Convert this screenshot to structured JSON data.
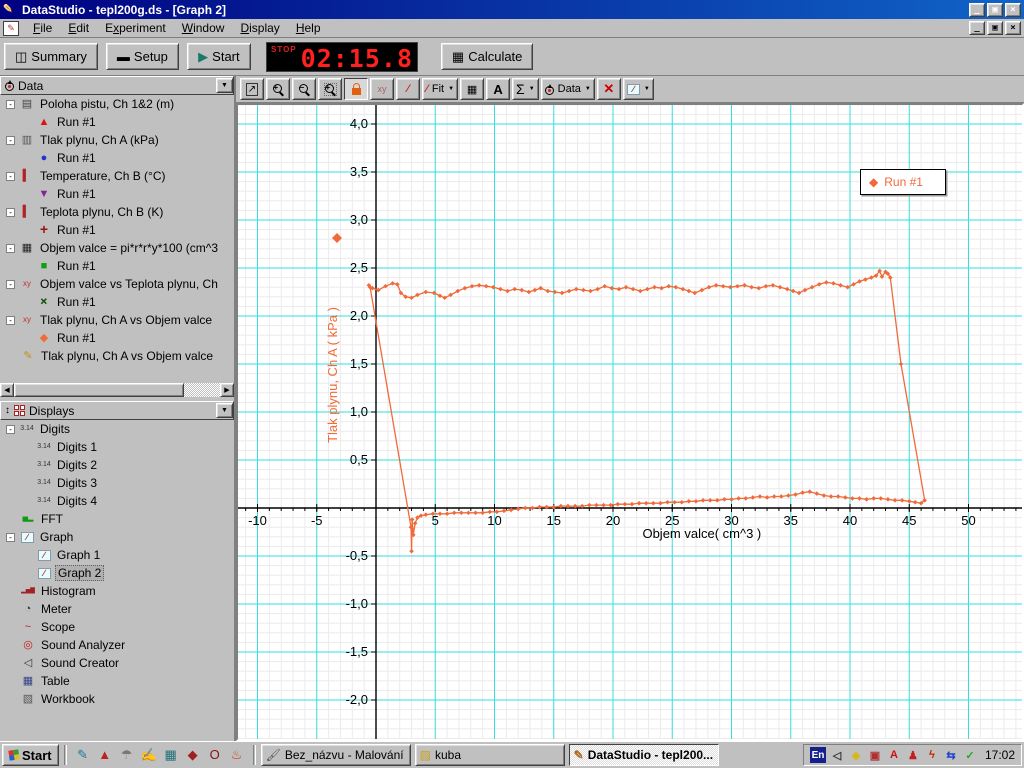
{
  "window": {
    "title": "DataStudio - tepl200g.ds - [Graph 2]"
  },
  "menu": {
    "items": [
      {
        "label": "File",
        "u": 0
      },
      {
        "label": "Edit",
        "u": 0
      },
      {
        "label": "Experiment",
        "u": 1
      },
      {
        "label": "Window",
        "u": 0
      },
      {
        "label": "Display",
        "u": 0
      },
      {
        "label": "Help",
        "u": 0
      }
    ]
  },
  "main_toolbar": {
    "summary_label": "Summary",
    "setup_label": "Setup",
    "start_label": "Start",
    "calculate_label": "Calculate",
    "timer": {
      "stop_label": "STOP",
      "value": "02:15.8"
    }
  },
  "graph_toolbar": {
    "buttons": [
      {
        "name": "scale-to-fit-button",
        "icon": "scalefit"
      },
      {
        "name": "zoom-in-button",
        "icon": "mag-plus"
      },
      {
        "name": "zoom-out-button",
        "icon": "mag-minus"
      },
      {
        "name": "zoom-select-button",
        "icon": "mag-rect"
      },
      {
        "name": "smart-tool-button",
        "icon": "lock",
        "pressed": true
      },
      {
        "name": "xy-tool-button",
        "icon": "xy",
        "disabled": true
      },
      {
        "name": "slope-tool-button",
        "icon": "slope",
        "disabled": true
      },
      {
        "name": "fit-menu-button",
        "icon": "slope",
        "label": "Fit",
        "arrow": true
      },
      {
        "name": "calculator-button",
        "icon": "calc"
      },
      {
        "name": "text-tool-button",
        "icon": "textA"
      },
      {
        "name": "statistics-button",
        "icon": "sigma",
        "arrow": true
      },
      {
        "name": "data-menu-button",
        "icon": "droplet",
        "label": "Data",
        "arrow": true
      },
      {
        "name": "delete-button",
        "icon": "redx"
      },
      {
        "name": "graph-settings-button",
        "icon": "minigraph",
        "arrow": true
      }
    ]
  },
  "sidebar": {
    "data_panel": {
      "title": "Data",
      "icon": "droplet-icon",
      "items": [
        {
          "label": "Poloha pistu, Ch 1&2 (m)",
          "icon": "motion-sensor-icon",
          "level": 0,
          "expand": true
        },
        {
          "label": "Run #1",
          "marker": "triangle-up",
          "color": "#dd1111",
          "level": 1
        },
        {
          "label": "Tlak plynu, Ch A (kPa)",
          "icon": "pressure-sensor-icon",
          "level": 0,
          "expand": true
        },
        {
          "label": "Run #1",
          "marker": "circle",
          "color": "#2233cc",
          "level": 1
        },
        {
          "label": "Temperature, Ch B (°C)",
          "icon": "temperature-sensor-icon",
          "level": 0,
          "expand": true
        },
        {
          "label": "Run #1",
          "marker": "triangle-down",
          "color": "#882299",
          "level": 1
        },
        {
          "label": "Teplota plynu, Ch B (K)",
          "icon": "temperature-sensor-icon",
          "level": 0,
          "expand": true
        },
        {
          "label": "Run #1",
          "marker": "plus",
          "color": "#991111",
          "level": 1
        },
        {
          "label": "Objem valce = pi*r*r*y*100 (cm^3",
          "icon": "calculator-icon",
          "level": 0,
          "expand": true
        },
        {
          "label": "Run #1",
          "marker": "square",
          "color": "#11a011",
          "level": 1
        },
        {
          "label": "Objem valce vs Teplota plynu, Ch",
          "icon": "xy-data-icon",
          "level": 0,
          "expand": true
        },
        {
          "label": "Run #1",
          "marker": "x-cross",
          "color": "#115511",
          "level": 1
        },
        {
          "label": "Tlak plynu, Ch A vs Objem valce",
          "icon": "xy-data-icon",
          "level": 0,
          "expand": true
        },
        {
          "label": "Run #1",
          "marker": "diamond",
          "color": "#f06a3a",
          "level": 1
        },
        {
          "label": "Tlak plynu, Ch A vs Objem valce",
          "icon": "pencil-icon",
          "level": 0
        }
      ]
    },
    "displays_panel": {
      "title": "Displays",
      "icon": "grid-icon",
      "items": [
        {
          "label": "Digits",
          "icon": "digits-icon",
          "level": 0,
          "expand": true
        },
        {
          "label": "Digits 1",
          "icon": "digits-icon",
          "level": 1
        },
        {
          "label": "Digits 2",
          "icon": "digits-icon",
          "level": 1
        },
        {
          "label": "Digits 3",
          "icon": "digits-icon",
          "level": 1
        },
        {
          "label": "Digits 4",
          "icon": "digits-icon",
          "level": 1
        },
        {
          "label": "FFT",
          "icon": "fft-icon",
          "level": 0
        },
        {
          "label": "Graph",
          "icon": "graph-icon",
          "level": 0,
          "expand": true
        },
        {
          "label": "Graph 1",
          "icon": "graph-icon",
          "level": 1
        },
        {
          "label": "Graph 2",
          "icon": "graph-icon",
          "level": 1,
          "selected": true
        },
        {
          "label": "Histogram",
          "icon": "histogram-icon",
          "level": 0
        },
        {
          "label": "Meter",
          "icon": "meter-icon",
          "level": 0
        },
        {
          "label": "Scope",
          "icon": "scope-icon",
          "level": 0
        },
        {
          "label": "Sound Analyzer",
          "icon": "sound-analyzer-icon",
          "level": 0
        },
        {
          "label": "Sound Creator",
          "icon": "sound-creator-icon",
          "level": 0
        },
        {
          "label": "Table",
          "icon": "table-icon",
          "level": 0
        },
        {
          "label": "Workbook",
          "icon": "workbook-icon",
          "level": 0
        }
      ]
    }
  },
  "legend": {
    "label": "Run #1",
    "color": "#f06a3a"
  },
  "chart_data": {
    "type": "scatter",
    "title": "",
    "xlabel": "Objem valce( cm^3 )",
    "ylabel": "Tlak plynu, Ch A ( kPa )",
    "xlim": [
      -11.6,
      54.6
    ],
    "ylim": [
      -2.4,
      4.2
    ],
    "x_tick_step": 5,
    "x_minor_step": 1,
    "y_tick_step": 0.5,
    "y_minor_step": 0.1,
    "grid": "on",
    "legend_position": "upper-right",
    "axis_color": "#000000",
    "major_grid_color": "#33dede",
    "minor_grid_color": "#ebebeb",
    "series": [
      {
        "name": "Run #1",
        "color": "#f06a3a",
        "marker": "diamond",
        "points": [
          [
            -0.6,
            2.32
          ],
          [
            -0.3,
            2.29
          ],
          [
            0.2,
            2.27
          ],
          [
            0.8,
            2.31
          ],
          [
            1.4,
            2.34
          ],
          [
            1.8,
            2.33
          ],
          [
            2.1,
            2.24
          ],
          [
            2.5,
            2.2
          ],
          [
            3.0,
            2.19
          ],
          [
            3.5,
            2.22
          ],
          [
            4.2,
            2.25
          ],
          [
            4.9,
            2.24
          ],
          [
            5.4,
            2.21
          ],
          [
            5.8,
            2.19
          ],
          [
            6.3,
            2.22
          ],
          [
            6.9,
            2.26
          ],
          [
            7.5,
            2.29
          ],
          [
            8.1,
            2.31
          ],
          [
            8.7,
            2.32
          ],
          [
            9.3,
            2.31
          ],
          [
            9.9,
            2.3
          ],
          [
            10.5,
            2.28
          ],
          [
            11.1,
            2.26
          ],
          [
            11.7,
            2.28
          ],
          [
            12.3,
            2.27
          ],
          [
            12.9,
            2.25
          ],
          [
            13.4,
            2.27
          ],
          [
            13.9,
            2.29
          ],
          [
            14.5,
            2.26
          ],
          [
            15.1,
            2.25
          ],
          [
            15.7,
            2.24
          ],
          [
            16.3,
            2.26
          ],
          [
            16.9,
            2.28
          ],
          [
            17.5,
            2.27
          ],
          [
            18.1,
            2.26
          ],
          [
            18.7,
            2.28
          ],
          [
            19.3,
            2.31
          ],
          [
            19.9,
            2.29
          ],
          [
            20.5,
            2.28
          ],
          [
            21.1,
            2.3
          ],
          [
            21.7,
            2.28
          ],
          [
            22.3,
            2.26
          ],
          [
            22.9,
            2.28
          ],
          [
            23.5,
            2.3
          ],
          [
            24.1,
            2.29
          ],
          [
            24.7,
            2.31
          ],
          [
            25.3,
            2.3
          ],
          [
            25.9,
            2.28
          ],
          [
            26.4,
            2.26
          ],
          [
            26.9,
            2.24
          ],
          [
            27.5,
            2.27
          ],
          [
            28.1,
            2.3
          ],
          [
            28.7,
            2.32
          ],
          [
            29.3,
            2.31
          ],
          [
            29.9,
            2.3
          ],
          [
            30.5,
            2.31
          ],
          [
            31.1,
            2.32
          ],
          [
            31.7,
            2.3
          ],
          [
            32.3,
            2.29
          ],
          [
            32.9,
            2.31
          ],
          [
            33.5,
            2.32
          ],
          [
            34.1,
            2.3
          ],
          [
            34.7,
            2.28
          ],
          [
            35.2,
            2.26
          ],
          [
            35.7,
            2.24
          ],
          [
            36.2,
            2.27
          ],
          [
            36.8,
            2.3
          ],
          [
            37.4,
            2.33
          ],
          [
            38.0,
            2.35
          ],
          [
            38.6,
            2.34
          ],
          [
            39.2,
            2.32
          ],
          [
            39.8,
            2.3
          ],
          [
            40.3,
            2.33
          ],
          [
            40.8,
            2.36
          ],
          [
            41.3,
            2.38
          ],
          [
            41.8,
            2.4
          ],
          [
            42.2,
            2.42
          ],
          [
            42.5,
            2.47
          ],
          [
            42.7,
            2.41
          ],
          [
            43.0,
            2.46
          ],
          [
            43.2,
            2.44
          ],
          [
            43.4,
            2.4
          ],
          [
            44.3,
            1.5
          ],
          [
            46.3,
            0.08
          ],
          [
            46.0,
            0.05
          ],
          [
            45.5,
            0.06
          ],
          [
            45.0,
            0.07
          ],
          [
            44.4,
            0.08
          ],
          [
            43.8,
            0.08
          ],
          [
            43.2,
            0.09
          ],
          [
            42.6,
            0.1
          ],
          [
            42.0,
            0.1
          ],
          [
            41.4,
            0.09
          ],
          [
            40.8,
            0.1
          ],
          [
            40.2,
            0.1
          ],
          [
            39.6,
            0.11
          ],
          [
            39.0,
            0.12
          ],
          [
            38.4,
            0.12
          ],
          [
            37.8,
            0.13
          ],
          [
            37.2,
            0.15
          ],
          [
            36.6,
            0.17
          ],
          [
            36.0,
            0.16
          ],
          [
            35.4,
            0.14
          ],
          [
            34.8,
            0.13
          ],
          [
            34.2,
            0.12
          ],
          [
            33.6,
            0.12
          ],
          [
            33.0,
            0.11
          ],
          [
            32.4,
            0.12
          ],
          [
            31.8,
            0.11
          ],
          [
            31.2,
            0.1
          ],
          [
            30.6,
            0.1
          ],
          [
            30.0,
            0.09
          ],
          [
            29.4,
            0.09
          ],
          [
            28.8,
            0.08
          ],
          [
            28.2,
            0.08
          ],
          [
            27.6,
            0.08
          ],
          [
            27.0,
            0.07
          ],
          [
            26.4,
            0.07
          ],
          [
            25.8,
            0.06
          ],
          [
            25.2,
            0.06
          ],
          [
            24.6,
            0.06
          ],
          [
            24.0,
            0.05
          ],
          [
            23.4,
            0.05
          ],
          [
            22.8,
            0.05
          ],
          [
            22.2,
            0.05
          ],
          [
            21.6,
            0.04
          ],
          [
            21.0,
            0.04
          ],
          [
            20.4,
            0.04
          ],
          [
            19.8,
            0.03
          ],
          [
            19.2,
            0.03
          ],
          [
            18.6,
            0.03
          ],
          [
            18.0,
            0.03
          ],
          [
            17.4,
            0.02
          ],
          [
            16.8,
            0.02
          ],
          [
            16.2,
            0.02
          ],
          [
            15.6,
            0.02
          ],
          [
            15.0,
            0.01
          ],
          [
            14.4,
            0.01
          ],
          [
            13.8,
            0.01
          ],
          [
            13.2,
            0.0
          ],
          [
            12.6,
            0.0
          ],
          [
            12.0,
            -0.01
          ],
          [
            11.4,
            -0.02
          ],
          [
            10.8,
            -0.03
          ],
          [
            10.2,
            -0.04
          ],
          [
            9.6,
            -0.04
          ],
          [
            9.0,
            -0.05
          ],
          [
            8.4,
            -0.05
          ],
          [
            7.8,
            -0.05
          ],
          [
            7.2,
            -0.05
          ],
          [
            6.6,
            -0.05
          ],
          [
            6.0,
            -0.06
          ],
          [
            5.4,
            -0.06
          ],
          [
            4.8,
            -0.06
          ],
          [
            4.2,
            -0.07
          ],
          [
            3.8,
            -0.08
          ],
          [
            3.5,
            -0.1
          ],
          [
            3.3,
            -0.16
          ],
          [
            3.15,
            -0.28
          ],
          [
            3.05,
            -0.12
          ],
          [
            3.0,
            -0.45
          ],
          [
            2.95,
            -0.2
          ],
          [
            -0.5,
            2.3
          ]
        ]
      }
    ]
  },
  "taskbar": {
    "start_label": "Start",
    "quick_launch": [
      "show-desktop-icon",
      "acrobat-icon",
      "bird-icon",
      "compose-icon",
      "calculator-icon",
      "dragon-icon",
      "opera-icon",
      "grill-icon"
    ],
    "tasks": [
      {
        "label": "Bez_názvu - Malování",
        "icon": "paint-icon",
        "active": false
      },
      {
        "label": "kuba",
        "icon": "folder-icon",
        "active": false
      },
      {
        "label": "DataStudio - tepl200...",
        "icon": "datastudio-icon",
        "active": true
      }
    ],
    "tray": {
      "icons": [
        "language-indicator",
        "volume-icon",
        "diamond-icon",
        "scheduler-icon",
        "ati-icon",
        "figure-icon",
        "lightning-icon",
        "sync-icon",
        "pen-icon"
      ],
      "language_label": "En",
      "clock": "17:02"
    }
  }
}
